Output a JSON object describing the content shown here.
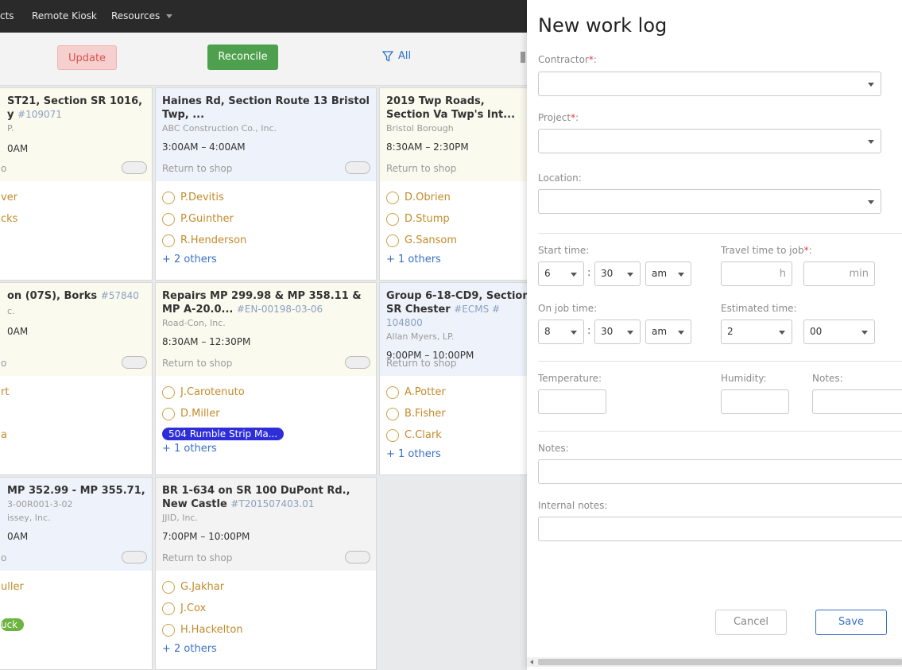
{
  "nav": {
    "items": [
      "cts",
      "Remote Kiosk",
      "Resources"
    ]
  },
  "actions": {
    "update": "Update",
    "reconcile": "Reconcile",
    "filter": "All"
  },
  "cards": [
    {
      "title": "ST21, Section SR 1016,",
      "title2": "y",
      "number": "#109071",
      "company": "P.",
      "time": "0AM",
      "return": "o",
      "people": [
        "ver",
        "cks"
      ],
      "others": "",
      "tag": "",
      "tag_color": ""
    },
    {
      "title": "Haines Rd, Section Route 13 Bristol Twp, ...",
      "title2": "",
      "number": "",
      "company": "ABC Construction Co., Inc.",
      "time": "3:00AM – 4:00AM",
      "return": "Return to shop",
      "people": [
        "P.Devitis",
        "P.Guinther",
        "R.Henderson"
      ],
      "others": "+ 2 others",
      "tag": "",
      "tag_color": ""
    },
    {
      "title": "2019 Twp Roads, Section Va Twp's Int...",
      "title2": "",
      "number": "",
      "company": "Bristol Borough",
      "time": "8:30AM – 2:30PM",
      "return": "Return to shop",
      "people": [
        "D.Obrien",
        "D.Stump",
        "G.Sansom"
      ],
      "others": "+ 1 others",
      "tag": "",
      "tag_color": ""
    },
    {
      "title": "on (07S), Borks",
      "title2": "",
      "number": "#57840",
      "company": "c.",
      "time": "0AM",
      "return": "o",
      "people": [
        "rt",
        "",
        "a"
      ],
      "others": "",
      "tag": "",
      "tag_color": ""
    },
    {
      "title": "Repairs MP 299.98 & MP 358.11 & MP A-20.0...",
      "title2": "",
      "number": "#EN-00198-03-06",
      "company": "Road-Con, Inc.",
      "time": "8:30AM – 12:30PM",
      "return": "Return to shop",
      "people": [
        "J.Carotenuto",
        "D.Miller"
      ],
      "others": "+ 1 others",
      "tag": "504 Rumble Strip Ma...",
      "tag_color": "#2e2ed8"
    },
    {
      "title": "Group 6-18-CD9, Section SR Chester",
      "title2": "",
      "number": "#ECMS # 104800",
      "company": "Allan Myers, LP.",
      "time": "9:00PM – 10:00PM",
      "return": "Return to shop",
      "people": [
        "A.Potter",
        "B.Fisher",
        "C.Clark"
      ],
      "others": "+ 1 others",
      "tag": "",
      "tag_color": ""
    },
    {
      "title": "MP 352.99 - MP 355.71,",
      "title2": "",
      "number": "3-00R001-3-02",
      "company": "issey, Inc.",
      "time": "0AM",
      "return": "o",
      "people": [
        "uller"
      ],
      "others": "",
      "tag": "uck",
      "tag_color": "#6db33f"
    },
    {
      "title": "BR 1-634 on SR 100 DuPont Rd., New Castle",
      "title2": "",
      "number": "#T201507403.01",
      "company": "JJID, Inc.",
      "time": "7:00PM – 10:00PM",
      "return": "Return to shop",
      "people": [
        "G.Jakhar",
        "J.Cox",
        "H.Hackelton"
      ],
      "others": "+ 2 others",
      "tag": "",
      "tag_color": ""
    }
  ],
  "panel": {
    "title": "New work log",
    "contractor_label": "Contractor",
    "project_label": "Project",
    "location_label": "Location:",
    "required_mark": "*",
    "colon": ":",
    "start_time_label": "Start time:",
    "start_hour": "6",
    "start_min": "30",
    "start_ampm": "am",
    "travel_label": "Travel time to job",
    "travel_h_unit": "h",
    "travel_min_unit": "min",
    "onjob_label": "On job time:",
    "onjob_hour": "8",
    "onjob_min": "30",
    "onjob_ampm": "am",
    "estimated_label": "Estimated time:",
    "est_hours": "2",
    "est_min": "00",
    "temperature_label": "Temperature:",
    "humidity_label": "Humidity:",
    "notes_small_label": "Notes:",
    "notes_label": "Notes:",
    "internal_notes_label": "Internal notes:",
    "cancel": "Cancel",
    "save": "Save"
  }
}
